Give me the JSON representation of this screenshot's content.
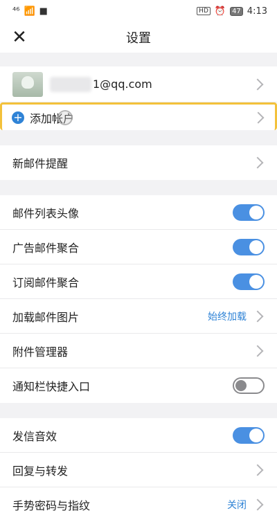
{
  "status": {
    "signal": "⁴⁶",
    "time": "4:13",
    "hd": "HD",
    "battery": "47"
  },
  "header": {
    "title": "设置"
  },
  "account": {
    "email": "1@qq.com",
    "add_account": "添加帐户"
  },
  "rows_1": [
    {
      "label": "新邮件提醒"
    }
  ],
  "rows_2": [
    {
      "label": "邮件列表头像",
      "toggle": true
    },
    {
      "label": "广告邮件聚合",
      "toggle": true
    },
    {
      "label": "订阅邮件聚合",
      "toggle": true
    },
    {
      "label": "加载邮件图片",
      "value": "始终加载"
    },
    {
      "label": "附件管理器"
    },
    {
      "label": "通知栏快捷入口",
      "toggle": false
    }
  ],
  "rows_3": [
    {
      "label": "发信音效",
      "toggle": true
    },
    {
      "label": "回复与转发"
    },
    {
      "label": "手势密码与指纹",
      "value": "关闭"
    }
  ],
  "colors": {
    "accent": "#4a90e2",
    "highlight": "#f3c13a",
    "link": "#2f83d6"
  }
}
